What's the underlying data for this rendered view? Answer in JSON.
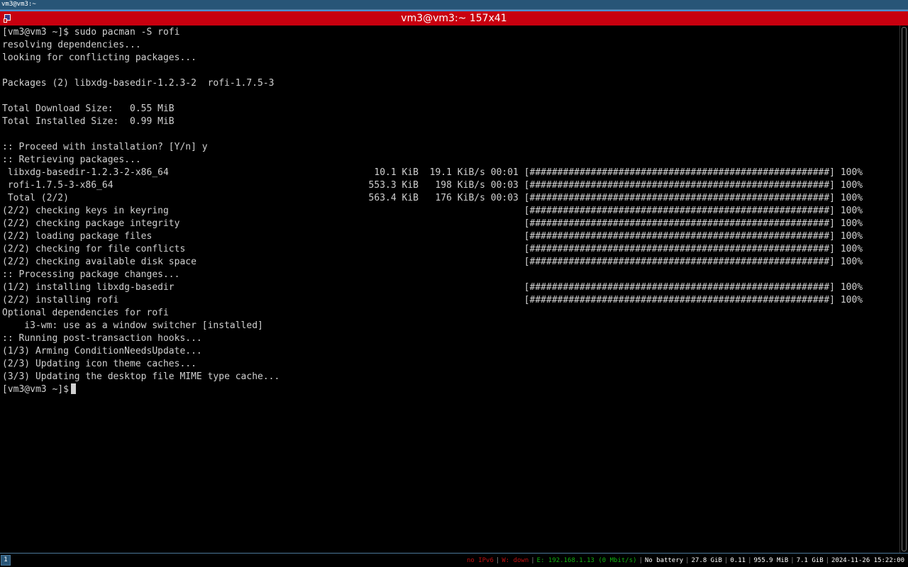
{
  "i3_tab": {
    "title": "vm3@vm3:~"
  },
  "window": {
    "title": "vm3@vm3:~ 157x41"
  },
  "terminal": {
    "lines": [
      "[vm3@vm3 ~]$ sudo pacman -S rofi",
      "resolving dependencies...",
      "looking for conflicting packages...",
      "",
      "Packages (2) libxdg-basedir-1.2.3-2  rofi-1.7.5-3",
      "",
      "Total Download Size:   0.55 MiB",
      "Total Installed Size:  0.99 MiB",
      "",
      ":: Proceed with installation? [Y/n] y",
      ":: Retrieving packages...",
      " libxdg-basedir-1.2.3-2-x86_64                                     10.1 KiB  19.1 KiB/s 00:01 [######################################################] 100%",
      " rofi-1.7.5-3-x86_64                                              553.3 KiB   198 KiB/s 00:03 [######################################################] 100%",
      " Total (2/2)                                                      563.4 KiB   176 KiB/s 00:03 [######################################################] 100%",
      "(2/2) checking keys in keyring                                                                [######################################################] 100%",
      "(2/2) checking package integrity                                                              [######################################################] 100%",
      "(2/2) loading package files                                                                   [######################################################] 100%",
      "(2/2) checking for file conflicts                                                             [######################################################] 100%",
      "(2/2) checking available disk space                                                           [######################################################] 100%",
      ":: Processing package changes...",
      "(1/2) installing libxdg-basedir                                                               [######################################################] 100%",
      "(2/2) installing rofi                                                                         [######################################################] 100%",
      "Optional dependencies for rofi",
      "    i3-wm: use as a window switcher [installed]",
      ":: Running post-transaction hooks...",
      "(1/3) Arming ConditionNeedsUpdate...",
      "(2/3) Updating icon theme caches...",
      "(3/3) Updating the desktop file MIME type cache..."
    ],
    "prompt": "[vm3@vm3 ~]$"
  },
  "statusbar": {
    "workspace": "1",
    "items": [
      {
        "name": "ipv6",
        "text": "no IPv6",
        "color": "#c01010"
      },
      {
        "name": "wireless",
        "text": "W: down",
        "color": "#c01010"
      },
      {
        "name": "ethernet",
        "text": "E: 192.168.1.13 (0 Mbit/s)",
        "color": "#10b010"
      },
      {
        "name": "battery",
        "text": "No battery",
        "color": "#ffffff"
      },
      {
        "name": "disk",
        "text": "27.8 GiB",
        "color": "#ffffff"
      },
      {
        "name": "load",
        "text": "0.11",
        "color": "#ffffff"
      },
      {
        "name": "memory",
        "text": "955.9 MiB",
        "color": "#ffffff"
      },
      {
        "name": "swap",
        "text": "7.1 GiB",
        "color": "#ffffff"
      },
      {
        "name": "datetime",
        "text": "2024-11-26 15:22:00",
        "color": "#ffffff"
      }
    ]
  }
}
